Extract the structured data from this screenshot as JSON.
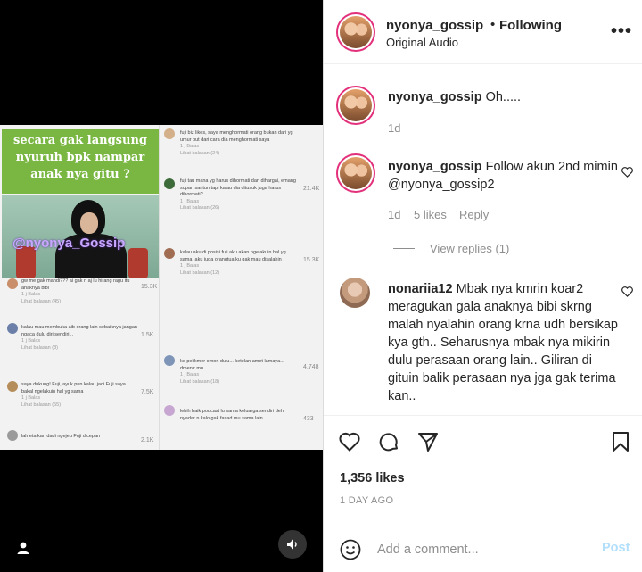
{
  "video": {
    "caption_overlay": "secara gak langsung nyuruh bpk nampar anak nya gitu ?",
    "watermark": "@nyonya_Gossip",
    "left_comments": [
      {
        "user": "",
        "text": "gw me gak mandi??? ai gak n aj lu hirang ragu itu anaknya bibi",
        "meta": "1 j   Balas",
        "replies": "Lihat balasan (45)",
        "likes": "15.3K"
      },
      {
        "user": "",
        "text": "kalau mau membuka aib orang lain sebaiknya jangan ngaca dulu diri sendiri...",
        "meta": "1 j   Balas",
        "replies": "Lihat balasan (8)",
        "likes": "1.5K"
      },
      {
        "user": "",
        "text": "saya dukung! Fuji, ayuk pun kalau jadi Fuji saya bakal ngelakuin hal yg sama",
        "meta": "1 j   Balas",
        "replies": "Lihat balasan (55)",
        "likes": "7.5K"
      },
      {
        "user": "",
        "text": "lah eta kan dadi ngejeu Fuji dicepan",
        "meta": "",
        "replies": "",
        "likes": "2.1K"
      }
    ],
    "right_comments": [
      {
        "user": "",
        "text": "fuji biz likes, saya menghormati orang bukan dari yg umur but dari cara dia menghormati saya",
        "meta": "1 j   Balas",
        "replies": "Lihat balasan (24)",
        "likes": ""
      },
      {
        "user": "",
        "text": "fuji tau mana yg harus dihormati dan dihargai, emang sopan santun tapi kalau dia ditusuk juga harus dihormati?",
        "meta": "1 j   Balas",
        "replies": "Lihat balasan (26)",
        "likes": "21.4K"
      },
      {
        "user": "",
        "text": "kalau aku di posisi fuji aku akan ngelakuin hal yg sama, aku juga orangtua ku gak mau disalahin",
        "meta": "1 j   Balas",
        "replies": "Lihat balasan (12)",
        "likes": "15.3K"
      },
      {
        "user": "",
        "text": "ke pelikmer omon dulu... ketelan amet lamaya... dmenir mu",
        "meta": "1 j   Balas",
        "replies": "Lihat balasan (18)",
        "likes": "4,748"
      },
      {
        "user": "",
        "text": "lebih baik podcast lu sama keluarga sendiri deh nyadar n kalo gak fasad mu sama lain",
        "meta": "",
        "replies": "",
        "likes": "433"
      }
    ]
  },
  "header": {
    "username": "nyonya_gossip",
    "dot": "•",
    "following": "Following",
    "audio": "Original Audio",
    "more": "•••"
  },
  "comments": [
    {
      "username": "nyonya_gossip",
      "text": "Oh.....",
      "time": "1d",
      "likes": "",
      "reply": ""
    },
    {
      "username": "nyonya_gossip",
      "text": "Follow akun 2nd mimin @nyonya_gossip2",
      "time": "1d",
      "likes": "5 likes",
      "reply": "Reply"
    },
    {
      "username": "nonariia12",
      "text": "Mbak nya kmrin koar2 meragukan gala anaknya bibi skrng malah nyalahin orang krna udh bersikap kya gth.. Seharusnya mbak nya mikirin dulu perasaan orang lain.. Giliran di gituin balik perasaan nya jga gak terima kan.."
    }
  ],
  "view_replies": "View replies (1)",
  "likes_count": "1,356 likes",
  "post_date": "1 DAY AGO",
  "comment_input": {
    "placeholder": "Add a comment...",
    "value": ""
  },
  "post_button": "Post",
  "colors": {
    "accent_blue": "#b2dffc",
    "caption_green": "#79b642",
    "story_ring": "#e3307a"
  }
}
